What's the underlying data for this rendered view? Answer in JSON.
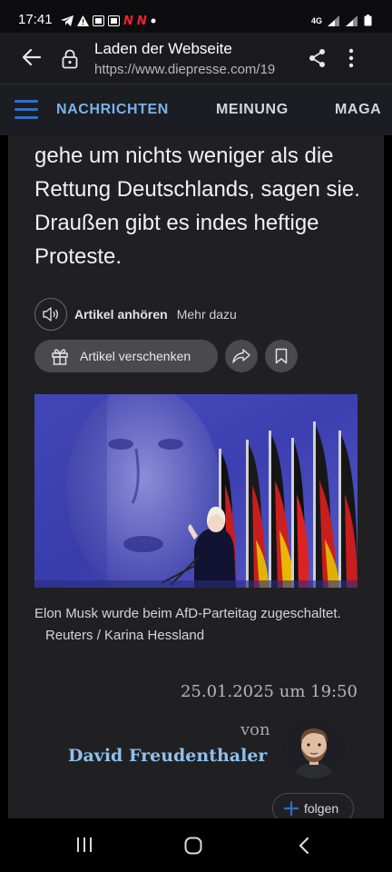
{
  "status_bar": {
    "time": "17:41",
    "notification_badges": [
      "N",
      "N"
    ],
    "network": "4G"
  },
  "browser": {
    "page_title": "Laden der Webseite",
    "url": "https://www.diepresse.com/19"
  },
  "site_nav": {
    "items": [
      "NACHRICHTEN",
      "MEINUNG",
      "MAGA"
    ]
  },
  "article": {
    "lead_text": "gehe um nichts weniger als die Rettung Deutschlands, sagen sie. Draußen gibt es indes heftige Proteste.",
    "listen_label": "Artikel anhören",
    "more_label": "Mehr dazu",
    "gift_label": "Artikel verschenken",
    "caption": "Elon Musk wurde beim AfD-Parteitag zugeschaltet.",
    "photo_credit": "Reuters / Karina Hessland",
    "date": "25.01.2025 um 19:50",
    "byline_prefix": "von",
    "author": "David Freudenthaler",
    "follow_label": "folgen"
  },
  "colors": {
    "accent_blue": "#7ab2e9",
    "author_blue": "#8fc0ec",
    "hamburger_blue": "#2f6fc4",
    "panel_bg": "#202022",
    "button_bg": "#4a4a4e"
  }
}
